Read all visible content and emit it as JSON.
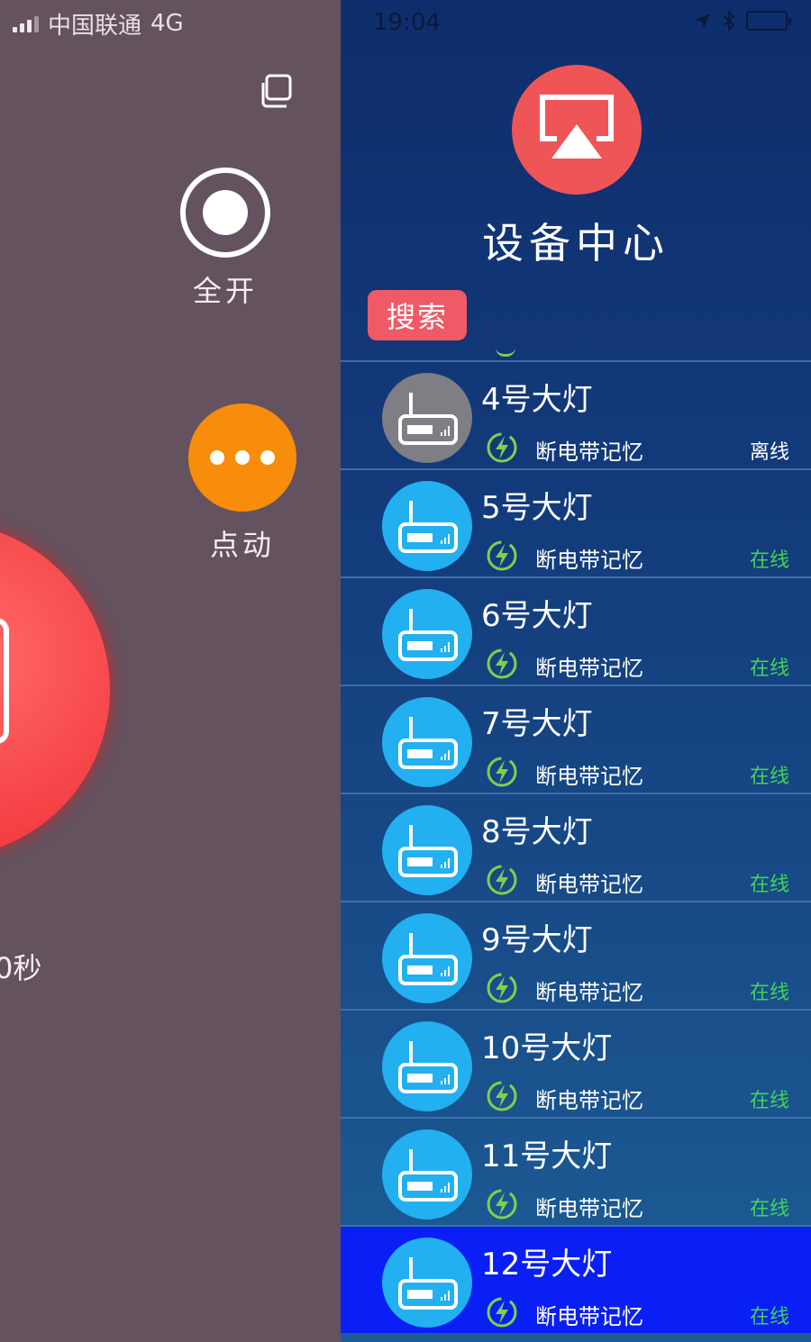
{
  "left_panel": {
    "carrier": "中国联通",
    "network": "4G",
    "all_on_label": "全开",
    "jog_label": "点动",
    "timer_fragment": "0秒",
    "colors": {
      "background": "#64525f",
      "jog": "#f88c0b",
      "power": "#f43a3f"
    }
  },
  "drawer": {
    "time": "19:04",
    "title": "设备中心",
    "search_label": "搜索",
    "colors": {
      "header_icon": "#ef5557",
      "search": "#ef5a66",
      "online": "#41d35a",
      "device_icon": "#22b0f0",
      "offline_icon": "#7e7e84",
      "selected_row": "#0a1ff5"
    },
    "devices": [
      {
        "name": "4号大灯",
        "memory": "断电带记忆",
        "status": "离线"
      },
      {
        "name": "5号大灯",
        "memory": "断电带记忆",
        "status": "在线"
      },
      {
        "name": "6号大灯",
        "memory": "断电带记忆",
        "status": "在线"
      },
      {
        "name": "7号大灯",
        "memory": "断电带记忆",
        "status": "在线"
      },
      {
        "name": "8号大灯",
        "memory": "断电带记忆",
        "status": "在线"
      },
      {
        "name": "9号大灯",
        "memory": "断电带记忆",
        "status": "在线"
      },
      {
        "name": "10号大灯",
        "memory": "断电带记忆",
        "status": "在线"
      },
      {
        "name": "11号大灯",
        "memory": "断电带记忆",
        "status": "在线"
      },
      {
        "name": "12号大灯",
        "memory": "断电带记忆",
        "status": "在线"
      }
    ]
  }
}
